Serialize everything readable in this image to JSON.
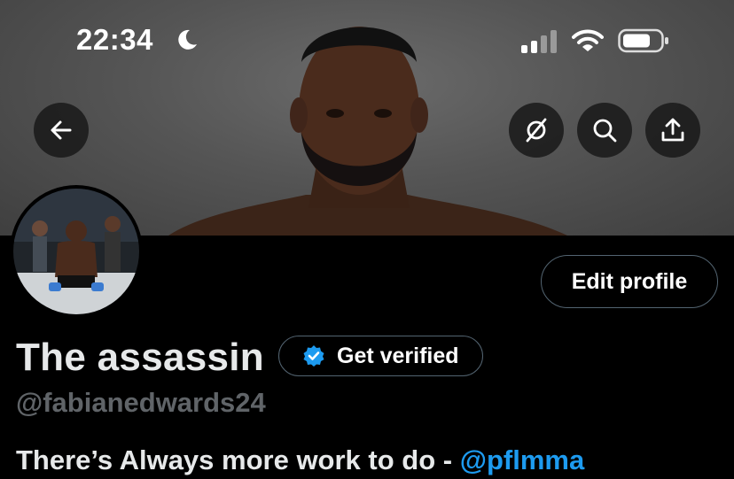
{
  "status_bar": {
    "time": "22:34",
    "icons": [
      "moon-icon",
      "signal-icon",
      "wifi-icon",
      "battery-icon"
    ]
  },
  "header": {
    "buttons": [
      "back-arrow-icon",
      "grok-icon",
      "search-icon",
      "share-icon"
    ]
  },
  "profile": {
    "display_name": "The assassin",
    "handle": "@fabianedwards24",
    "edit_label": "Edit profile",
    "verify_label": "Get verified",
    "bio_text": "There’s Always more work to do - ",
    "bio_mention": "@pflmma"
  },
  "colors": {
    "background": "#000000",
    "accent": "#1d9bf0",
    "muted": "#71767b",
    "border": "#536471"
  }
}
